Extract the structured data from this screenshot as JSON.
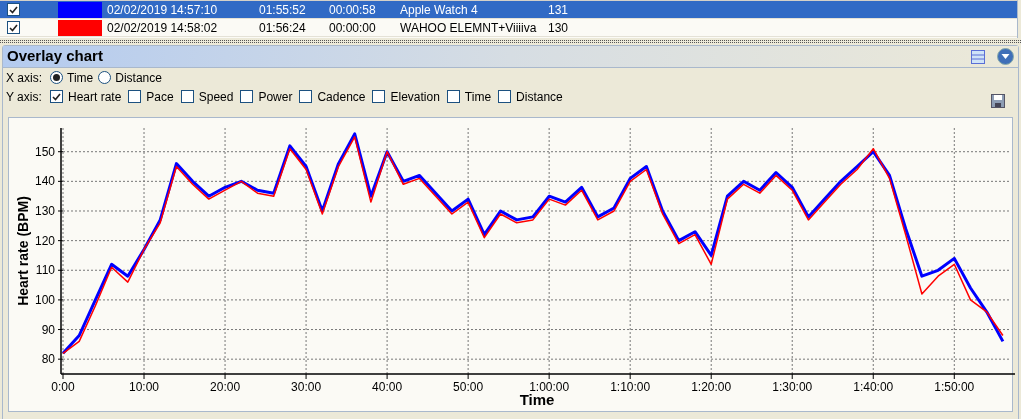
{
  "table": {
    "rows": [
      {
        "checked": true,
        "selected": true,
        "color": "#0000ff",
        "cells": [
          "02/02/2019 14:57:10",
          "01:55:52",
          "00:00:58",
          "Apple Watch 4",
          "131"
        ]
      },
      {
        "checked": true,
        "selected": false,
        "color": "#ff0000",
        "cells": [
          "02/02/2019 14:58:02",
          "01:56:24",
          "00:00:00",
          "WAHOO ELEMNT+Viiiiva",
          "130"
        ]
      }
    ]
  },
  "panel": {
    "title": "Overlay chart",
    "x_axis": {
      "label": "X axis:",
      "options": [
        {
          "label": "Time",
          "selected": true
        },
        {
          "label": "Distance",
          "selected": false
        }
      ]
    },
    "y_axis": {
      "label": "Y axis:",
      "options": [
        {
          "label": "Heart rate",
          "checked": true
        },
        {
          "label": "Pace",
          "checked": false
        },
        {
          "label": "Speed",
          "checked": false
        },
        {
          "label": "Power",
          "checked": false
        },
        {
          "label": "Cadence",
          "checked": false
        },
        {
          "label": "Elevation",
          "checked": false
        },
        {
          "label": "Time",
          "checked": false
        },
        {
          "label": "Distance",
          "checked": false
        }
      ]
    },
    "chart_data": {
      "type": "line",
      "xlabel": "Time",
      "ylabel": "Heart rate (BPM)",
      "x": [
        0,
        2,
        4,
        6,
        8,
        10,
        12,
        14,
        16,
        18,
        20,
        22,
        24,
        26,
        28,
        30,
        32,
        34,
        36,
        38,
        40,
        42,
        44,
        46,
        48,
        50,
        52,
        54,
        56,
        58,
        60,
        62,
        64,
        66,
        68,
        70,
        72,
        74,
        76,
        78,
        80,
        82,
        84,
        86,
        88,
        90,
        92,
        94,
        96,
        98,
        100,
        102,
        104,
        106,
        108,
        110,
        112,
        114,
        116
      ],
      "series": [
        {
          "color": "#0000ff",
          "values": [
            82,
            88,
            100,
            112,
            108,
            117,
            127,
            146,
            140,
            135,
            138,
            140,
            137,
            136,
            152,
            145,
            130,
            146,
            156,
            135,
            150,
            140,
            142,
            136,
            130,
            134,
            122,
            130,
            127,
            128,
            135,
            133,
            138,
            128,
            131,
            141,
            145,
            130,
            120,
            123,
            115,
            135,
            140,
            137,
            143,
            138,
            128,
            134,
            140,
            145,
            150,
            142,
            124,
            108,
            110,
            114,
            104,
            96,
            86
          ]
        },
        {
          "color": "#ff0000",
          "values": [
            82,
            86,
            98,
            111,
            106,
            117,
            126,
            145,
            139,
            134,
            137,
            140,
            136,
            135,
            151,
            144,
            129,
            145,
            155,
            133,
            150,
            139,
            141,
            135,
            129,
            133,
            121,
            129,
            126,
            127,
            134,
            132,
            137,
            127,
            130,
            140,
            144,
            129,
            119,
            122,
            112,
            134,
            139,
            136,
            142,
            137,
            127,
            133,
            139,
            144,
            151,
            141,
            122,
            102,
            108,
            112,
            100,
            96,
            88
          ]
        }
      ],
      "xlim": [
        0,
        117
      ],
      "ylim": [
        75,
        158
      ],
      "grid": true,
      "xticks": [
        {
          "value": 0,
          "label": "0:00"
        },
        {
          "value": 10,
          "label": "10:00"
        },
        {
          "value": 20,
          "label": "20:00"
        },
        {
          "value": 30,
          "label": "30:00"
        },
        {
          "value": 40,
          "label": "40:00"
        },
        {
          "value": 50,
          "label": "50:00"
        },
        {
          "value": 60,
          "label": "1:00:00"
        },
        {
          "value": 70,
          "label": "1:10:00"
        },
        {
          "value": 80,
          "label": "1:20:00"
        },
        {
          "value": 90,
          "label": "1:30:00"
        },
        {
          "value": 100,
          "label": "1:40:00"
        },
        {
          "value": 110,
          "label": "1:50:00"
        }
      ],
      "yticks": [
        80,
        90,
        100,
        110,
        120,
        130,
        140,
        150
      ]
    }
  }
}
